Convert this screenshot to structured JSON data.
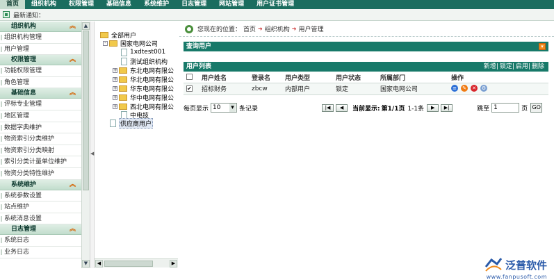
{
  "topnav": [
    "首页",
    "组织机构",
    "权限管理",
    "基础信息",
    "系统维护",
    "日志管理",
    "网站管理",
    "用户证书管理"
  ],
  "notice": {
    "label": "最新通知："
  },
  "sidebar": [
    {
      "title": "组织机构",
      "items": [
        "组织机构管理",
        "用户管理"
      ]
    },
    {
      "title": "权限管理",
      "items": [
        "功能权限管理",
        "角色管理"
      ]
    },
    {
      "title": "基础信息",
      "items": [
        "评标专业管理",
        "地区管理",
        "数据字典维护",
        "物资索引分类维护",
        "物资索引分类映射",
        "索引分类计量单位维护",
        "物资分类特性维护"
      ]
    },
    {
      "title": "系统维护",
      "items": [
        "系统参数设置",
        "站点维护",
        "系统消息设置"
      ]
    },
    {
      "title": "日志管理",
      "items": [
        "系统日志",
        "业务日志"
      ]
    }
  ],
  "tree": {
    "root": "全部用户",
    "company": "国家电网公司",
    "children": [
      "1xdtest001",
      "测试组织机构",
      "东北电网有限公",
      "华北电网有限公",
      "华东电网有限公",
      "华中电网有限公",
      "西北电网有限公",
      "中电技"
    ],
    "supplier": "供应商用户"
  },
  "breadcrumb": {
    "prefix": "您现在的位置：",
    "items": [
      "首页",
      "组织机构",
      "用户管理"
    ]
  },
  "query_bar": "查询用户",
  "list_bar": {
    "title": "用户列表",
    "actions": [
      "新增",
      "锁定",
      "启用",
      "删除"
    ]
  },
  "table": {
    "headers": [
      "",
      "用户姓名",
      "登录名",
      "用户类型",
      "用户状态",
      "所属部门",
      "操作"
    ],
    "rows": [
      {
        "name": "招标财务",
        "login": "zbcw",
        "type": "内部用户",
        "status": "锁定",
        "dept": "国家电网公司"
      }
    ]
  },
  "pager": {
    "per_page_label": "每页显示",
    "per_page": "10",
    "records": "条记录",
    "current_label": "当前显示:",
    "page": "第1/1页",
    "range": "1-1条",
    "goto_label": "跳至",
    "goto_value": "1",
    "page_unit": "页",
    "go": "GO"
  },
  "logo": {
    "name": "泛普软件",
    "url": "www.fanpusoft.com"
  },
  "colors": {
    "nav": "#1b6d5f",
    "bar": "#177969",
    "accent": "#f08a1c"
  }
}
